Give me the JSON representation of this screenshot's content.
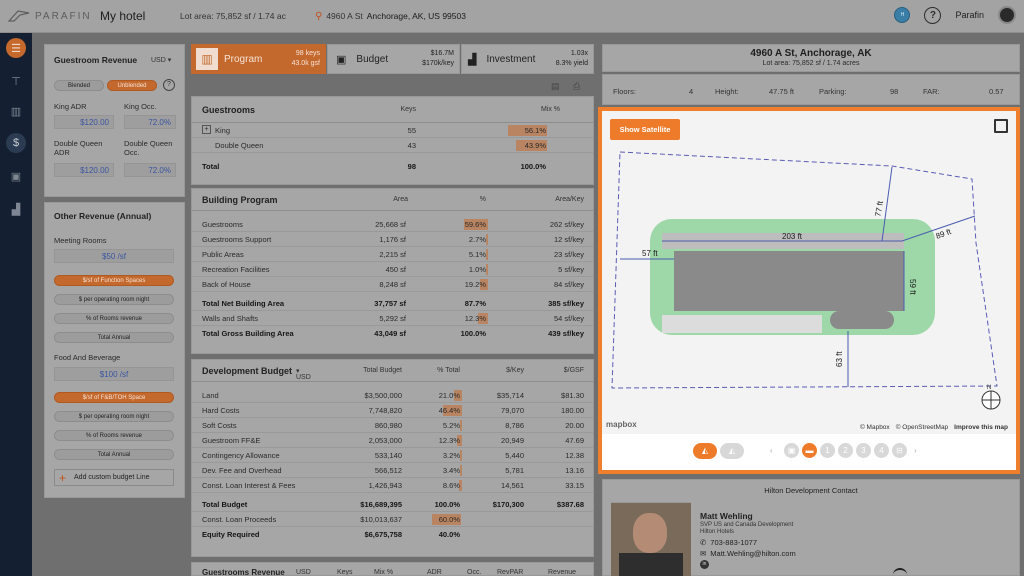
{
  "app": {
    "logo_text": "PARAFIN",
    "page_title": "My hotel",
    "lot_area": "Lot area: 75,852 sf / 1.74 ac",
    "address_street": "4960 A St",
    "address_city": "Anchorage, AK, US 99503",
    "user": "Parafin"
  },
  "revenue": {
    "title": "Guestroom Revenue",
    "currency": "USD",
    "tab_blended": "Blended",
    "tab_unblended": "Unblended",
    "king_adr_label": "King ADR",
    "king_adr": "$120.00",
    "king_occ_label": "King Occ.",
    "king_occ": "72.0%",
    "dq_adr_label": "Double Queen ADR",
    "dq_adr": "$120.00",
    "dq_occ_label": "Double Queen Occ.",
    "dq_occ": "72.0%"
  },
  "other_revenue": {
    "title": "Other Revenue (Annual)",
    "meeting_label": "Meeting Rooms",
    "meeting_val": "$50 /sf",
    "meeting_opts": [
      "$/sf of Function Spaces",
      "$ per operating room night",
      "% of Rooms revenue",
      "Total Annual"
    ],
    "fb_label": "Food And Beverage",
    "fb_val": "$100 /sf",
    "fb_opts": [
      "$/sf of F&B/TOH Space",
      "$ per operating room night",
      "% of Rooms revenue",
      "Total Annual"
    ],
    "add_line": "Add custom budget Line"
  },
  "tabs": {
    "program_label": "Program",
    "program_keys": "98 keys",
    "program_gsf": "43.0k gsf",
    "budget_label": "Budget",
    "budget_total": "$16.7M",
    "budget_perkey": "$170k/key",
    "invest_label": "Investment",
    "invest_mult": "1.03x",
    "invest_yield": "8.3% yield"
  },
  "guestrooms": {
    "title": "Guestrooms",
    "col_keys": "Keys",
    "col_mix": "Mix %",
    "rows": [
      {
        "name": "King",
        "keys": "55",
        "mix": "56.1%",
        "pct": 0.561
      },
      {
        "name": "Double Queen",
        "keys": "43",
        "mix": "43.9%",
        "pct": 0.439
      }
    ],
    "total_label": "Total",
    "total_keys": "98",
    "total_mix": "100.0%"
  },
  "building": {
    "title": "Building Program",
    "col_area": "Area",
    "col_pct": "%",
    "col_perkey": "Area/Key",
    "rows": [
      {
        "name": "Guestrooms",
        "area": "25,668 sf",
        "pct": "59.6%",
        "perkey": "262 sf/key",
        "p": 0.596
      },
      {
        "name": "Guestrooms Support",
        "area": "1,176 sf",
        "pct": "2.7%",
        "perkey": "12 sf/key",
        "p": 0.027
      },
      {
        "name": "Public Areas",
        "area": "2,215 sf",
        "pct": "5.1%",
        "perkey": "23 sf/key",
        "p": 0.051
      },
      {
        "name": "Recreation Facilities",
        "area": "450 sf",
        "pct": "1.0%",
        "perkey": "5 sf/key",
        "p": 0.01
      },
      {
        "name": "Back of House",
        "area": "8,248 sf",
        "pct": "19.2%",
        "perkey": "84 sf/key",
        "p": 0.192
      }
    ],
    "net_label": "Total Net Building Area",
    "net_area": "37,757 sf",
    "net_pct": "87.7%",
    "net_perkey": "385 sf/key",
    "walls_label": "Walls and Shafts",
    "walls_area": "5,292 sf",
    "walls_pct": "12.3%",
    "walls_perkey": "54 sf/key",
    "walls_p": 0.123,
    "gross_label": "Total Gross Building Area",
    "gross_area": "43,049 sf",
    "gross_pct": "100.0%",
    "gross_perkey": "439 sf/key"
  },
  "devbudget": {
    "title": "Development Budget",
    "currency": "USD",
    "col_total": "Total Budget",
    "col_pct": "% Total",
    "col_key": "$/Key",
    "col_gsf": "$/GSF",
    "rows": [
      {
        "name": "Land",
        "total": "$3,500,000",
        "pct": "21.0%",
        "key": "$35,714",
        "gsf": "$81.30",
        "p": 0.21
      },
      {
        "name": "Hard Costs",
        "total": "7,748,820",
        "pct": "46.4%",
        "key": "79,070",
        "gsf": "180.00",
        "p": 0.464
      },
      {
        "name": "Soft Costs",
        "total": "860,980",
        "pct": "5.2%",
        "key": "8,786",
        "gsf": "20.00",
        "p": 0.052
      },
      {
        "name": "Guestroom FF&E",
        "total": "2,053,000",
        "pct": "12.3%",
        "key": "20,949",
        "gsf": "47.69",
        "p": 0.123
      },
      {
        "name": "Contingency Allowance",
        "total": "533,140",
        "pct": "3.2%",
        "key": "5,440",
        "gsf": "12.38",
        "p": 0.032
      },
      {
        "name": "Dev. Fee and Overhead",
        "total": "566,512",
        "pct": "3.4%",
        "key": "5,781",
        "gsf": "13.16",
        "p": 0.034
      },
      {
        "name": "Const. Loan Interest & Fees",
        "total": "1,426,943",
        "pct": "8.6%",
        "key": "14,561",
        "gsf": "33.15",
        "p": 0.086
      }
    ],
    "total_label": "Total Budget",
    "total": "$16,689,395",
    "total_pct": "100.0%",
    "total_key": "$170,300",
    "total_gsf": "$387.68",
    "loan_label": "Const. Loan Proceeds",
    "loan": "$10,013,637",
    "loan_pct": "60.0%",
    "loan_p": 0.6,
    "equity_label": "Equity Required",
    "equity": "$6,675,758",
    "equity_pct": "40.0%"
  },
  "bottom_table": {
    "title": "Guestrooms Revenue",
    "currency": "USD",
    "cols": [
      "Keys",
      "Mix %",
      "ADR",
      "Occ.",
      "RevPAR",
      "Revenue"
    ]
  },
  "site": {
    "address": "4960 A St, Anchorage, AK",
    "lot": "Lot area: 75,852 sf / 1.74 acres",
    "floors_label": "Floors:",
    "floors": "4",
    "height_label": "Height:",
    "height": "47.75 ft",
    "parking_label": "Parking:",
    "parking": "98",
    "far_label": "FAR:",
    "far": "0.57"
  },
  "map": {
    "show_satellite": "Show Satellite",
    "dim_top": "203 ft",
    "dim_left": "57 ft",
    "dim_77": "77 ft",
    "dim_89": "89 ft",
    "dim_59": "59 ft",
    "dim_63": "63 ft",
    "north": "N",
    "attrib_mapbox": "© Mapbox",
    "attrib_osm": "© OpenStreetMap",
    "attrib_improve": "Improve this map",
    "mapbox_logo": "mapbox",
    "pages": [
      "1",
      "2",
      "3",
      "4"
    ]
  },
  "contact": {
    "title": "Hilton Development Contact",
    "name": "Matt Wehling",
    "role": "SVP US and Canada Development",
    "company": "Hilton Hotels",
    "phone": "703-883-1077",
    "email": "Matt.Wehling@hilton.com"
  },
  "colors": {
    "accent": "#ee7b2a",
    "nav_bg": "#142031",
    "highlight": "#b88461"
  }
}
